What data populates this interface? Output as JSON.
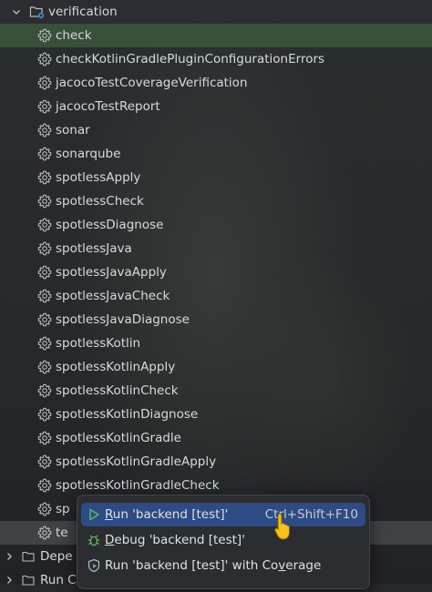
{
  "tree": {
    "group": {
      "label": "verification",
      "expanded": true
    },
    "tasks": [
      {
        "label": "check"
      },
      {
        "label": "checkKotlinGradlePluginConfigurationErrors"
      },
      {
        "label": "jacocoTestCoverageVerification"
      },
      {
        "label": "jacocoTestReport"
      },
      {
        "label": "sonar"
      },
      {
        "label": "sonarqube"
      },
      {
        "label": "spotlessApply"
      },
      {
        "label": "spotlessCheck"
      },
      {
        "label": "spotlessDiagnose"
      },
      {
        "label": "spotlessJava"
      },
      {
        "label": "spotlessJavaApply"
      },
      {
        "label": "spotlessJavaCheck"
      },
      {
        "label": "spotlessJavaDiagnose"
      },
      {
        "label": "spotlessKotlin"
      },
      {
        "label": "spotlessKotlinApply"
      },
      {
        "label": "spotlessKotlinCheck"
      },
      {
        "label": "spotlessKotlinDiagnose"
      },
      {
        "label": "spotlessKotlinGradle"
      },
      {
        "label": "spotlessKotlinGradleApply"
      },
      {
        "label": "spotlessKotlinGradleCheck"
      },
      {
        "label": "sp"
      },
      {
        "label": "te"
      }
    ],
    "bottom": [
      {
        "label": "Depe"
      },
      {
        "label": "Run C"
      }
    ],
    "selected_task": "check",
    "hovered_task": "te"
  },
  "context_menu": {
    "items": [
      {
        "mnemonic": "R",
        "rest": "un 'backend [test]'",
        "shortcut": "Ctrl+Shift+F10",
        "icon": "play-icon"
      },
      {
        "mnemonic": "D",
        "rest": "ebug 'backend [test]'",
        "shortcut": "",
        "icon": "debug-bug-icon"
      },
      {
        "label": "Run 'backend [test]' with Co",
        "mnemonic": "v",
        "rest": "erage",
        "shortcut": "",
        "icon": "coverage-shield-icon"
      }
    ],
    "active_index": 0
  },
  "colors": {
    "selection": "#3e5a3a",
    "menu_active": "#2e4b85",
    "play_icon": "#5fb865",
    "debug_icon": "#5fb865",
    "gear_icon": "#b8bbbf",
    "folder_icon": "#b8bbbf"
  }
}
